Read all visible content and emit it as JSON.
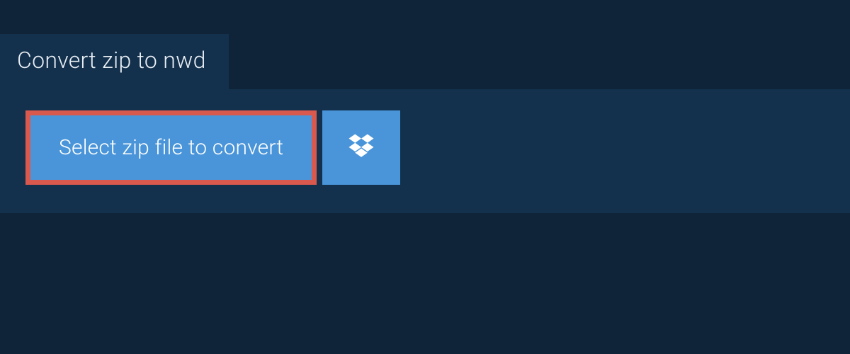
{
  "tab": {
    "label": "Convert zip to nwd"
  },
  "main": {
    "select_button_label": "Select zip file to convert",
    "dropbox_icon": "dropbox-icon"
  },
  "colors": {
    "background": "#0f2438",
    "panel": "#13314d",
    "button": "#4a95d9",
    "highlight_border": "#d9594f",
    "text_light": "#e8eef4",
    "text_white": "#ffffff"
  }
}
